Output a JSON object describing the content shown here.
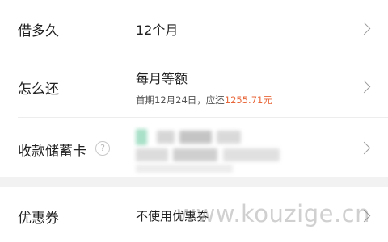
{
  "rows": {
    "term": {
      "label": "借多久",
      "value": "12个月"
    },
    "repayment": {
      "label": "怎么还",
      "value": "每月等额",
      "detail_prefix": "首期12月24日，应还",
      "detail_amount": "1255.71元"
    },
    "debit_card": {
      "label": "收款储蓄卡",
      "help_icon": "?"
    },
    "coupon": {
      "label": "优惠券",
      "value": "不使用优惠券"
    }
  },
  "watermark": "www.kouzige.cn",
  "colors": {
    "amount": "#e8673a",
    "background": "#f2f2f2",
    "card": "#ffffff",
    "chevron": "#9a9a9a"
  },
  "icons": [
    "chevron-right-icon",
    "help-icon"
  ]
}
